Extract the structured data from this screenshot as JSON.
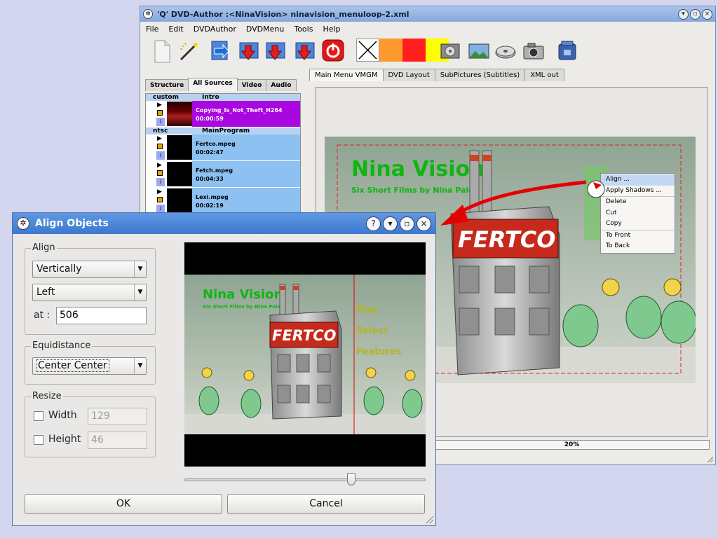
{
  "main_window": {
    "title": "'Q' DVD-Author :<NinaVision> ninavision_menuloop-2.xml",
    "menu": [
      "File",
      "Edit",
      "DVDAuthor",
      "DVDMenu",
      "Tools",
      "Help"
    ],
    "source_tabs": [
      "Structure",
      "All Sources",
      "Video",
      "Audio"
    ],
    "active_source_tab": "All Sources",
    "sources": {
      "groups": [
        {
          "name": "custom",
          "label": "Intro",
          "items": [
            {
              "name": "Copying_Is_Not_Theft_H264",
              "duration": "00:00:59",
              "selected": true
            }
          ]
        },
        {
          "name": "ntsc",
          "label": "MainProgram",
          "items": [
            {
              "name": "Fertco.mpeg",
              "duration": "00:02:47"
            },
            {
              "name": "Fetch.mpeg",
              "duration": "00:04:33"
            },
            {
              "name": "Lexi.mpeg",
              "duration": "00:02:19"
            }
          ]
        }
      ]
    },
    "work_tabs": [
      "Main Menu VMGM",
      "DVD Layout",
      "SubPictures (Subtitles)",
      "XML out"
    ],
    "active_work_tab": "Main Menu VMGM",
    "progress": "20%",
    "context_menu": [
      "Align ...",
      "Apply Shadows ...",
      "Delete",
      "Cut",
      "Copy",
      "To Front",
      "To Back"
    ],
    "scene": {
      "title": "Nina Vision",
      "subtitle": "Six Short Films by Nina Paley",
      "building_sign": "FERTCO"
    },
    "color_swatches": [
      "#ffffff",
      "#ff9b2e",
      "#ff1f1f",
      "#ffff00"
    ]
  },
  "dialog": {
    "title": "Align Objects",
    "align_group": "Align",
    "align_direction": "Vertically",
    "align_position": "Left",
    "at_label": "at :",
    "at_value": "506",
    "equidistance_group": "Equidistance",
    "equidistance_value": "Center Center",
    "resize_group": "Resize",
    "width_label": "Width",
    "width_value": "129",
    "height_label": "Height",
    "height_value": "46",
    "ok_label": "OK",
    "cancel_label": "Cancel",
    "preview": {
      "title": "Nina Vision",
      "subtitle": "Six Short Films by Nina Paley",
      "building_sign": "FERTCO",
      "buttons": [
        "Play",
        "Select",
        "Features"
      ]
    }
  }
}
